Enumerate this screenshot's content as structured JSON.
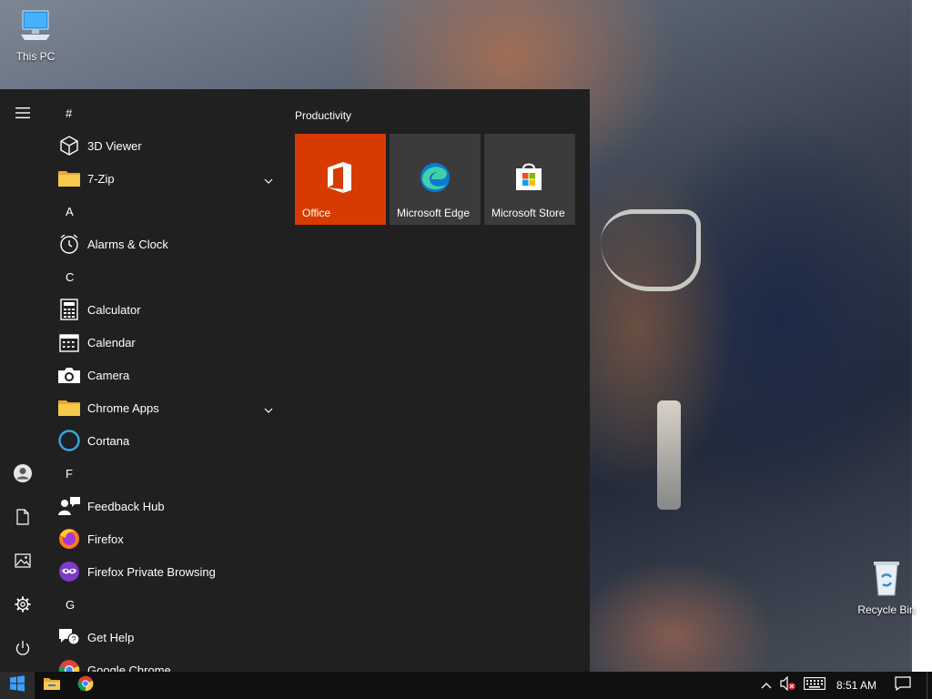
{
  "desktop": {
    "icons": [
      {
        "label": "This PC",
        "icon": "computer-icon"
      },
      {
        "label": "Recycle Bin",
        "icon": "recycle-bin-icon"
      }
    ]
  },
  "start_menu": {
    "rail": {
      "items": [
        {
          "name": "expand",
          "icon": "hamburger-icon"
        },
        {
          "name": "account",
          "icon": "user-icon"
        },
        {
          "name": "documents",
          "icon": "document-icon"
        },
        {
          "name": "pictures",
          "icon": "pictures-icon"
        },
        {
          "name": "settings",
          "icon": "gear-icon"
        },
        {
          "name": "power",
          "icon": "power-icon"
        }
      ]
    },
    "app_list": {
      "rows": [
        {
          "type": "letter",
          "label": "#"
        },
        {
          "type": "app",
          "label": "3D Viewer",
          "icon": "cube-icon"
        },
        {
          "type": "app",
          "label": "7-Zip",
          "icon": "folder-icon",
          "expandable": true
        },
        {
          "type": "letter",
          "label": "A"
        },
        {
          "type": "app",
          "label": "Alarms & Clock",
          "icon": "alarm-clock-icon"
        },
        {
          "type": "letter",
          "label": "C"
        },
        {
          "type": "app",
          "label": "Calculator",
          "icon": "calculator-icon"
        },
        {
          "type": "app",
          "label": "Calendar",
          "icon": "calendar-icon"
        },
        {
          "type": "app",
          "label": "Camera",
          "icon": "camera-icon"
        },
        {
          "type": "app",
          "label": "Chrome Apps",
          "icon": "folder-icon",
          "expandable": true
        },
        {
          "type": "app",
          "label": "Cortana",
          "icon": "cortana-icon"
        },
        {
          "type": "letter",
          "label": "F"
        },
        {
          "type": "app",
          "label": "Feedback Hub",
          "icon": "feedback-icon"
        },
        {
          "type": "app",
          "label": "Firefox",
          "icon": "firefox-icon"
        },
        {
          "type": "app",
          "label": "Firefox Private Browsing",
          "icon": "firefox-private-icon"
        },
        {
          "type": "letter",
          "label": "G"
        },
        {
          "type": "app",
          "label": "Get Help",
          "icon": "help-icon"
        },
        {
          "type": "app",
          "label": "Google Chrome",
          "icon": "chrome-icon"
        }
      ]
    },
    "tiles": {
      "group_title": "Productivity",
      "items": [
        {
          "label": "Office",
          "icon": "office-icon",
          "color": "#d83b01"
        },
        {
          "label": "Microsoft Edge",
          "icon": "edge-icon",
          "color": "#3b3b3b"
        },
        {
          "label": "Microsoft Store",
          "icon": "store-icon",
          "color": "#3b3b3b"
        }
      ]
    }
  },
  "taskbar": {
    "pinned": [
      {
        "name": "start",
        "icon": "windows-logo-icon"
      },
      {
        "name": "file-explorer",
        "icon": "folder-icon"
      },
      {
        "name": "chrome",
        "icon": "chrome-icon"
      }
    ],
    "tray": {
      "clock": "8:51 AM",
      "icons": [
        "chevron-up-icon",
        "volume-muted-icon",
        "keyboard-icon",
        "notification-icon"
      ]
    }
  },
  "colors": {
    "start_bg": "#202020",
    "tile_bg": "#3b3b3b",
    "office_tile": "#d83b01",
    "taskbar_bg": "#101010"
  }
}
